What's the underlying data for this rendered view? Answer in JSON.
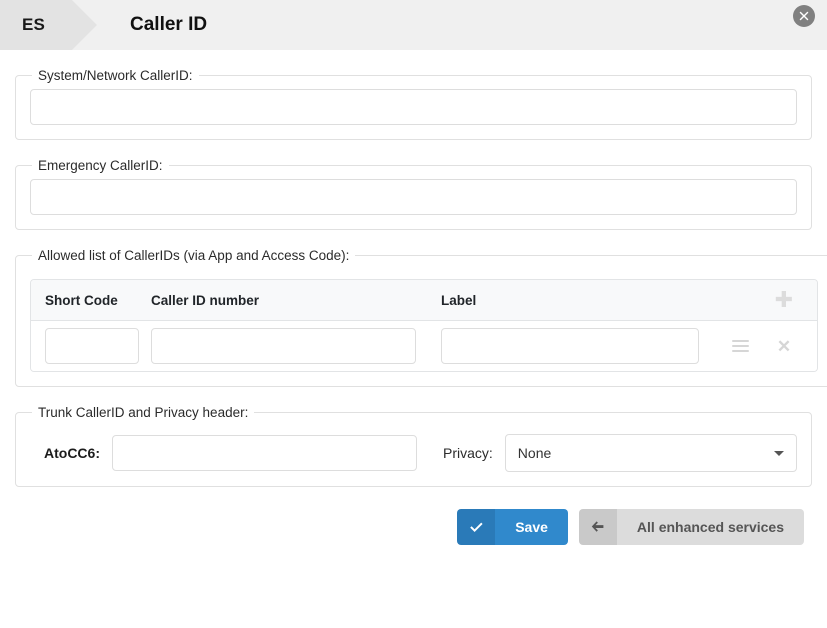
{
  "header": {
    "breadcrumb_chip": "ES",
    "title": "Caller ID",
    "close_icon": "close-circle-icon"
  },
  "sections": {
    "system_network": {
      "legend": "System/Network CallerID:",
      "input_value": "",
      "input_placeholder": ""
    },
    "emergency": {
      "legend": "Emergency CallerID:",
      "input_value": "",
      "input_placeholder": ""
    },
    "allowed_list": {
      "legend": "Allowed list of CallerIDs (via App and Access Code):",
      "add_icon": "plus-icon",
      "columns": [
        "Short Code",
        "Caller ID number",
        "Label"
      ],
      "rows": [
        {
          "short_code": "",
          "caller_id_number": "",
          "label": "",
          "drag_icon": "hamburger-drag-icon",
          "remove_icon": "close-x-icon"
        }
      ]
    },
    "trunk": {
      "legend": "Trunk CallerID and Privacy header:",
      "atocc6_label": "AtoCC6:",
      "atocc6_value": "",
      "privacy_label": "Privacy:",
      "privacy_value": "None",
      "privacy_options": [
        "None"
      ],
      "caret_icon": "chevron-down-icon"
    }
  },
  "footer": {
    "save_label": "Save",
    "save_icon": "check-icon",
    "back_label": "All enhanced services",
    "back_icon": "arrow-left-icon"
  },
  "colors": {
    "accent_blue": "#3089cc",
    "accent_blue_dark": "#2a7ab8",
    "button_gray": "#dcdcdc",
    "button_gray_dark": "#c9c9c9",
    "header_bg": "#f0f0f0",
    "chip_bg": "#e3e3e3"
  }
}
